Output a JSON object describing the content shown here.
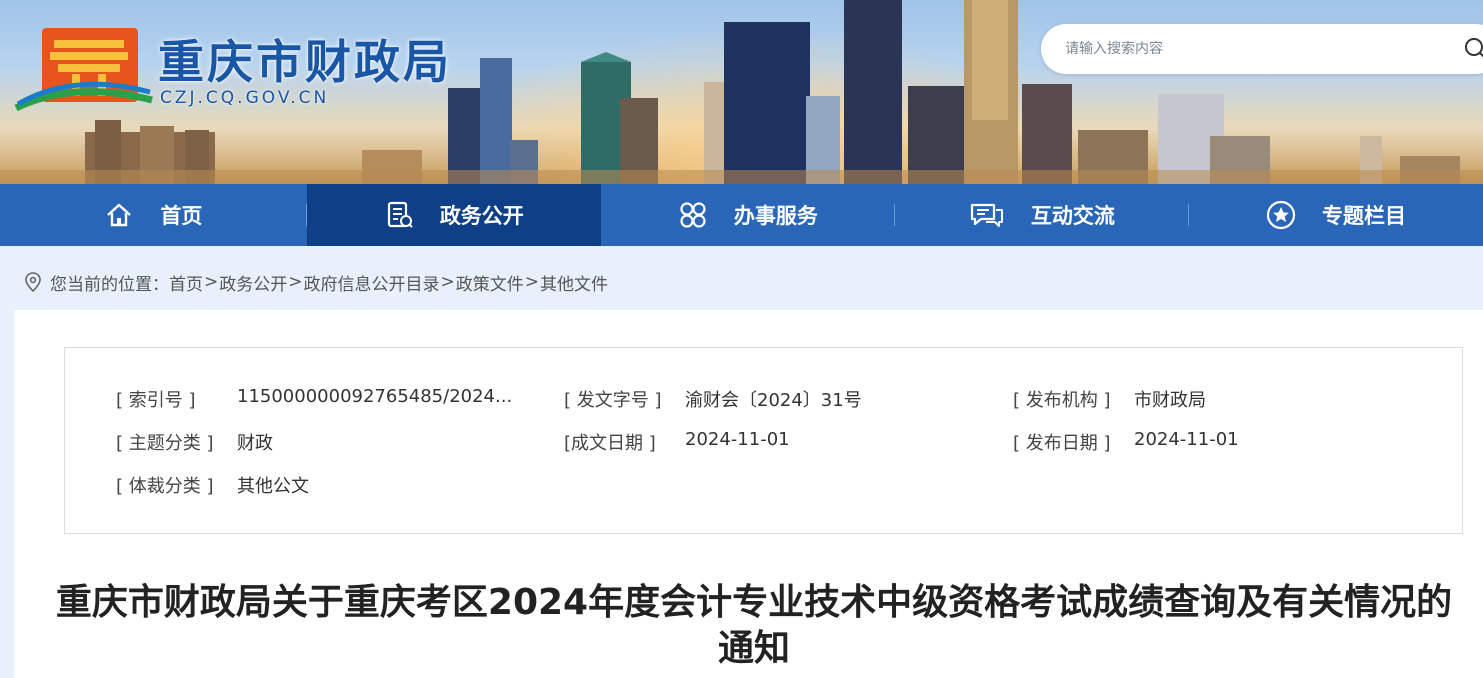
{
  "site": {
    "name": "重庆市财政局",
    "domain": "CZJ.CQ.GOV.CN"
  },
  "search": {
    "placeholder": "请输入搜索内容",
    "icon": "search-icon"
  },
  "nav": {
    "items": [
      {
        "label": "首页",
        "icon": "home-icon"
      },
      {
        "label": "政务公开",
        "icon": "document-icon"
      },
      {
        "label": "办事服务",
        "icon": "grid-icon"
      },
      {
        "label": "互动交流",
        "icon": "chat-icon"
      },
      {
        "label": "专题栏目",
        "icon": "star-icon"
      }
    ],
    "active_index": 1
  },
  "breadcrumb": {
    "prefix": "您当前的位置：",
    "items": [
      "首页",
      "政务公开",
      "政府信息公开目录",
      "政策文件",
      "其他文件"
    ],
    "separator": ">"
  },
  "meta": {
    "index_no": {
      "label": "[ 索引号 ]",
      "value": "115000000092765485/2024..."
    },
    "doc_no": {
      "label": "[ 发文字号 ]",
      "value": "渝财会〔2024〕31号"
    },
    "issuer": {
      "label": "[ 发布机构 ]",
      "value": "市财政局"
    },
    "topic": {
      "label": "[ 主题分类 ]",
      "value": "财政"
    },
    "created": {
      "label": "[成文日期 ]",
      "value": "2024-11-01"
    },
    "published": {
      "label": "[ 发布日期 ]",
      "value": "2024-11-01"
    },
    "genre": {
      "label": "[ 体裁分类 ]",
      "value": "其他公文"
    }
  },
  "document": {
    "title": "重庆市财政局关于重庆考区2024年度会计专业技术中级资格考试成绩查询及有关情况的通知"
  },
  "colors": {
    "nav_bg": "#2a66b8",
    "nav_active": "#0f3f86",
    "brand_blue": "#1a56a6",
    "page_bg": "#e8f1fb"
  }
}
